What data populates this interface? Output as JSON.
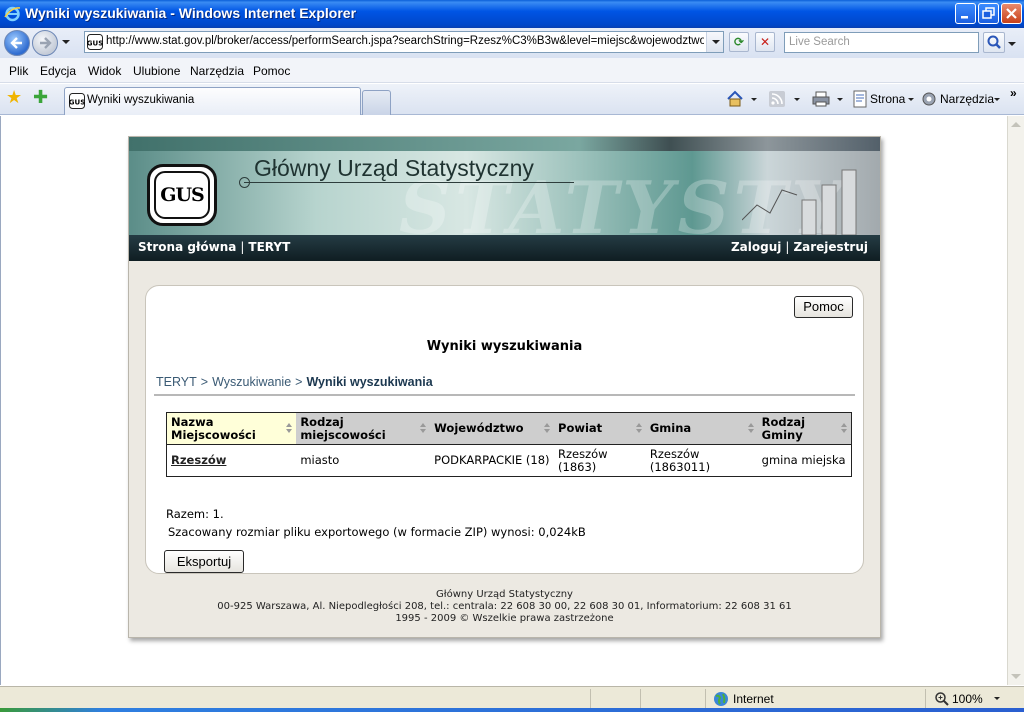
{
  "window": {
    "title": "Wyniki wyszukiwania - Windows Internet Explorer"
  },
  "toolbar": {
    "url": "http://www.stat.gov.pl/broker/access/performSearch.jspa?searchString=Rzesz%C3%B3w&level=miejsc&wojewodztwo=&p",
    "search_placeholder": "Live Search"
  },
  "menu": [
    "Plik",
    "Edycja",
    "Widok",
    "Ulubione",
    "Narzędzia",
    "Pomoc"
  ],
  "tabs": {
    "active_label": "Wyniki wyszukiwania"
  },
  "commandbar": {
    "page_label": "Strona",
    "tools_label": "Narzędzia"
  },
  "site": {
    "header_title": "Główny Urząd Statystyczny",
    "logo_text": "GUS",
    "watermark": "STATYSTY",
    "nav_left": [
      "Strona główna",
      "TERYT"
    ],
    "nav_right": [
      "Zaloguj",
      "Zarejestruj"
    ]
  },
  "content": {
    "help_button": "Pomoc",
    "page_title": "Wyniki wyszukiwania",
    "breadcrumb": [
      "TERYT",
      "Wyszukiwanie",
      "Wyniki wyszukiwania"
    ],
    "table": {
      "headers": [
        "Nazwa Miejscowości",
        "Rodzaj miejscowości",
        "Województwo",
        "Powiat",
        "Gmina",
        "Rodzaj Gminy"
      ],
      "rows": [
        [
          "Rzeszów",
          "miasto",
          "PODKARPACKIE (18)",
          "Rzeszów (1863)",
          "Rzeszów (1863011)",
          "gmina miejska"
        ]
      ]
    },
    "total": "Razem: 1.",
    "export_size": "Szacowany rozmiar pliku exportowego (w formacie ZIP) wynosi: 0,024kB",
    "export_button": "Eksportuj"
  },
  "footer": {
    "line1": "Główny Urząd Statystyczny",
    "line2": "00-925 Warszawa, Al. Niepodległości 208, tel.: centrala: 22 608 30 00, 22 608 30 01, Informatorium: 22 608 31 61",
    "line3": "1995 - 2009 © Wszelkie prawa zastrzeżone"
  },
  "status": {
    "zone": "Internet",
    "zoom": "100%"
  },
  "colors": {
    "titlebar": "#0055e5",
    "site_nav": "#1a2c33",
    "sorted_header": "#ffffd9"
  }
}
